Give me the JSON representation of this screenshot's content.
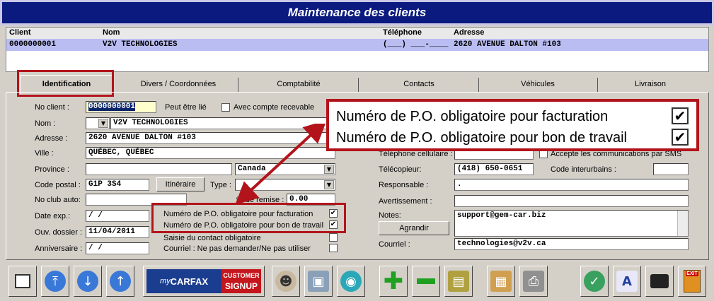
{
  "window": {
    "title": "Maintenance des clients"
  },
  "grid": {
    "headers": [
      "Client",
      "Nom",
      "Téléphone",
      "Adresse"
    ],
    "row": [
      "0000000001",
      "V2V TECHNOLOGIES",
      "(___) ___-____",
      "2620 AVENUE DALTON #103"
    ]
  },
  "tabs": [
    "Identification",
    "Divers / Coordonnées",
    "Comptabilité",
    "Contacts",
    "Véhicules",
    "Livraison"
  ],
  "form": {
    "no_client_label": "No client :",
    "no_client_value": "0000000001",
    "peut_etre_lie": "Peut être lié",
    "avec_compte": "Avec compte recevable",
    "nom_label": "Nom :",
    "nom_value": "V2V TECHNOLOGIES",
    "adresse_label": "Adresse :",
    "adresse_value": "2620 AVENUE DALTON #103",
    "ville_label": "Ville :",
    "ville_value": "QUÉBEC, QUÉBEC",
    "province_label": "Province :",
    "pays_value": "Canada",
    "code_postal_label": "Code postal :",
    "code_postal_value": "G1P 3S4",
    "itineraire_button": "Itinéraire",
    "type_label": "Type :",
    "no_club_label": "No club auto:",
    "remise_label": "% de remise :",
    "remise_value": "0.00",
    "date_exp_label": "Date exp.:",
    "date_exp_value": " / /",
    "ouv_dossier_label": "Ouv. dossier :",
    "ouv_dossier_value": "11/04/2011",
    "anniversaire_label": "Anniversaire :",
    "anniversaire_value": " / /",
    "po_facturation": "Numéro de P.O. obligatoire pour facturation",
    "po_bon_travail": "Numéro de P.O. obligatoire pour bon de travail",
    "saisie_contact": "Saisie du contact obligatoire",
    "courriel_ne_pas": "Courriel : Ne pas demander/Ne pas utiliser",
    "telephone_cell_label": "Téléphone cellulaire :",
    "accepte_sms": "Accepte les communications par SMS",
    "telecopieur_label": "Télécopieur:",
    "telecopieur_value": "(418) 650-0651",
    "code_interurbains_label": "Code interurbains :",
    "responsable_label": "Responsable :",
    "responsable_value": ".",
    "avertissement_label": "Avertissement :",
    "notes_label": "Notes:",
    "notes_value": "support@gem-car.biz",
    "agrandir_button": "Agrandir",
    "courriel_label": "Courriel :",
    "courriel_value": "technologies@v2v.ca"
  },
  "callout": {
    "line1": "Numéro de P.O. obligatoire pour facturation",
    "line2": "Numéro de P.O. obligatoire pour bon de travail"
  },
  "toolbar": {
    "carfax_my": "my",
    "carfax_brand": "CARFAX",
    "carfax_customer": "CUSTOMER",
    "carfax_signup": "SIGNUP",
    "exit": "EXIT"
  },
  "colors": {
    "title_bg": "#0a1a7e",
    "selected_row": "#b9bdf2",
    "callout_red": "#b3141b"
  }
}
